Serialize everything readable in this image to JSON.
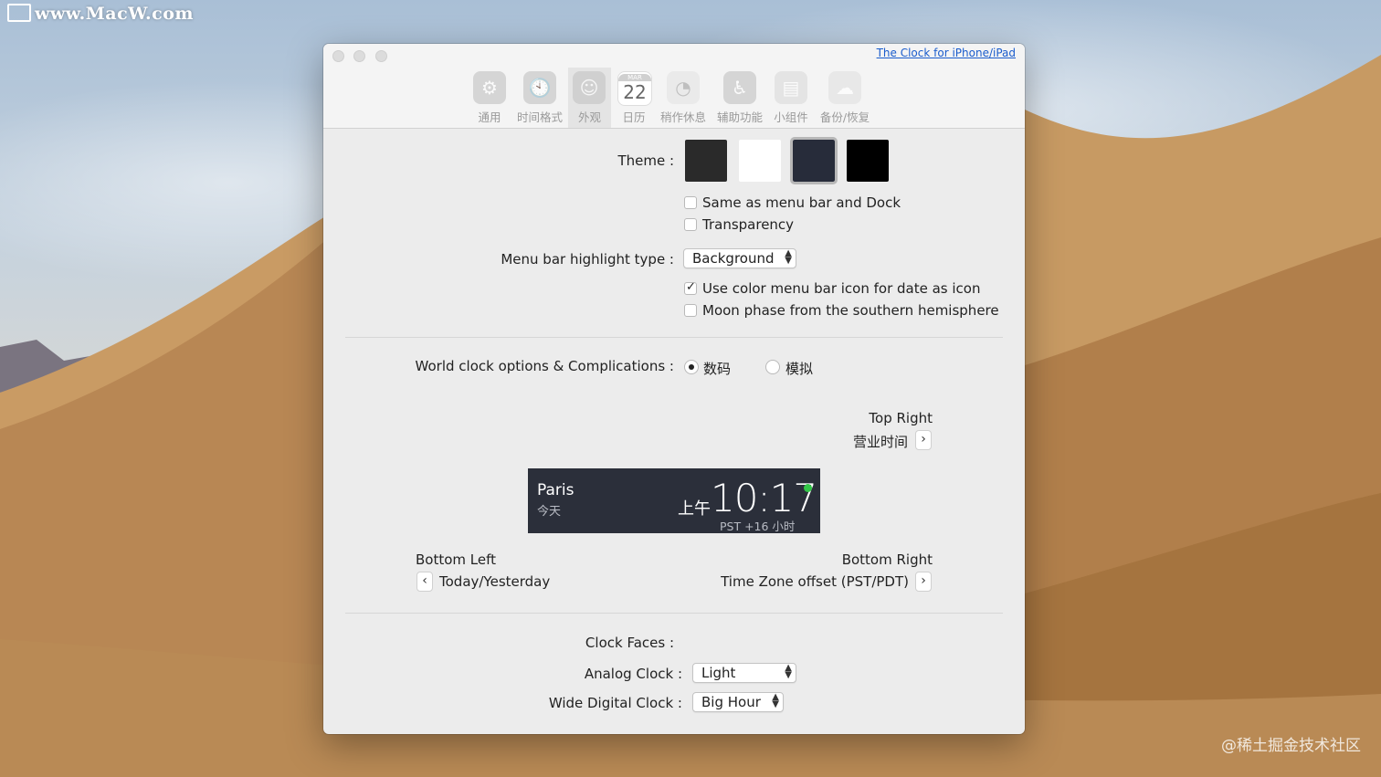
{
  "watermark": "www.MacW.com",
  "credit": "@稀土掘金技术社区",
  "window": {
    "top_link": "The Clock for iPhone/iPad",
    "toolbar": [
      {
        "label": "通用",
        "icon": "gear-icon"
      },
      {
        "label": "时间格式",
        "icon": "clock-icon"
      },
      {
        "label": "外观",
        "icon": "mask-icon"
      },
      {
        "label": "日历",
        "icon": "calendar-icon",
        "month": "MAR",
        "day": "22"
      },
      {
        "label": "稍作休息",
        "icon": "pie-timer-icon"
      },
      {
        "label": "辅助功能",
        "icon": "accessibility-icon"
      },
      {
        "label": "小组件",
        "icon": "widget-icon"
      },
      {
        "label": "备份/恢复",
        "icon": "cloud-icon"
      }
    ],
    "active_tab": "外观"
  },
  "appearance": {
    "theme_label": "Theme :",
    "theme_colors": [
      "#2a2a2a",
      "#ffffff",
      "#272c3a",
      "#000000"
    ],
    "selected_theme_index": 2,
    "same_as_menubar_label": "Same as menu bar and Dock",
    "same_as_menubar_checked": false,
    "transparency_label": "Transparency",
    "transparency_checked": false,
    "highlight_label": "Menu bar highlight type :",
    "highlight_value": "Background",
    "color_icon_label": "Use color menu bar icon for date as icon",
    "color_icon_checked": true,
    "moon_phase_label": "Moon phase from the southern hemisphere",
    "moon_phase_checked": false
  },
  "world_clock": {
    "label": "World clock options & Complications :",
    "option_digital": "数码",
    "option_analog": "模拟",
    "selected": "数码",
    "top_right_title": "Top Right",
    "top_right_value": "营业时间",
    "preview": {
      "city": "Paris",
      "day": "今天",
      "ampm": "上午",
      "time": "10:17",
      "offset": "PST +16 小时",
      "status_color": "#33c748"
    },
    "bottom_left_title": "Bottom Left",
    "bottom_left_value": "Today/Yesterday",
    "bottom_right_title": "Bottom Right",
    "bottom_right_value": "Time Zone offset (PST/PDT)"
  },
  "clock_faces": {
    "title": "Clock Faces :",
    "analog_label": "Analog Clock :",
    "analog_value": "Light",
    "wide_label": "Wide Digital Clock :",
    "wide_value": "Big Hour"
  }
}
